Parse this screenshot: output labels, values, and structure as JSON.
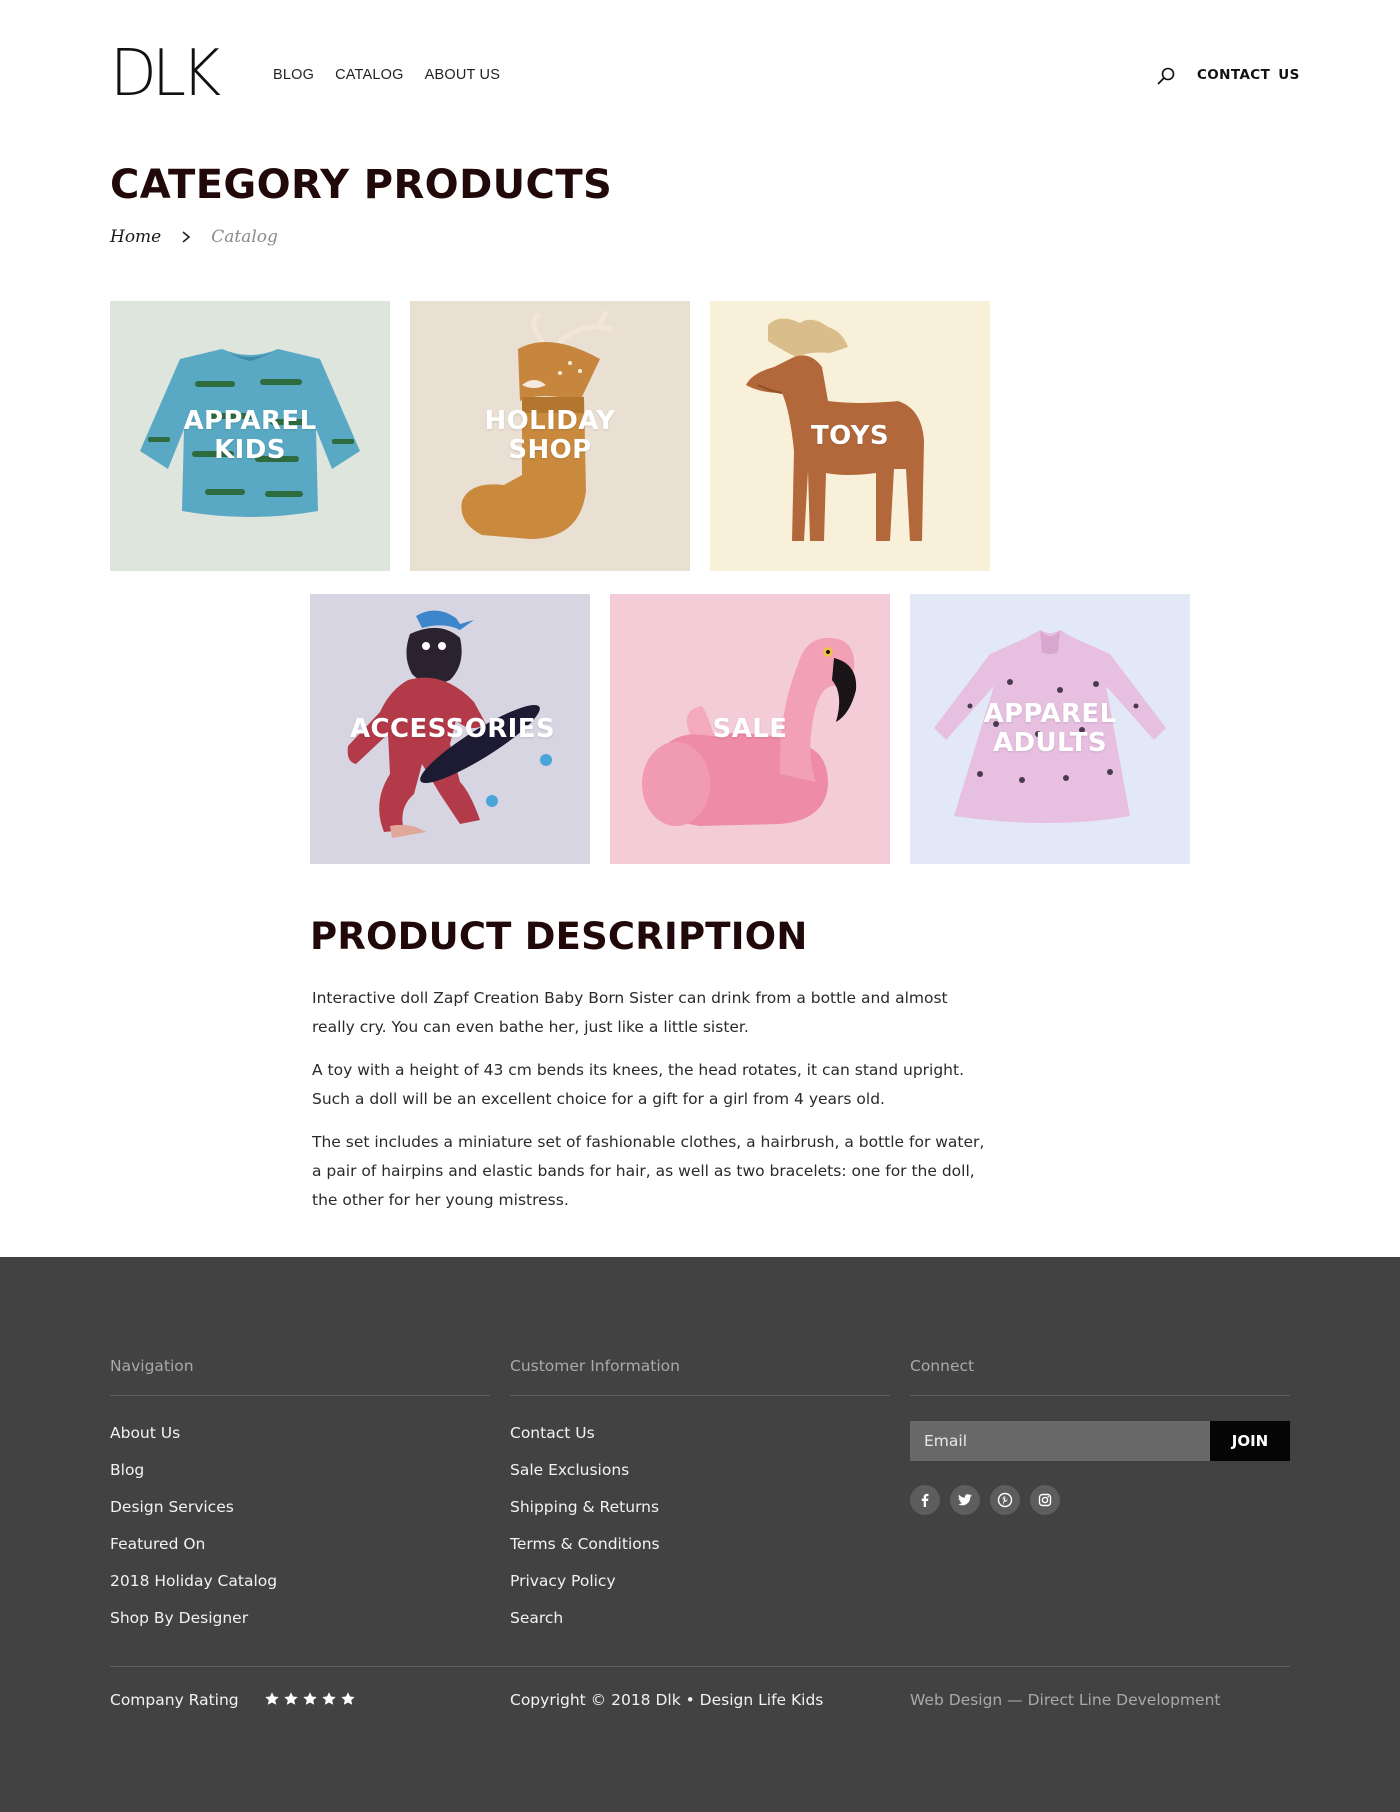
{
  "header": {
    "logo": "DLK",
    "nav": [
      "BLOG",
      "CATALOG",
      "ABOUT US"
    ],
    "contact": "CONTACT US"
  },
  "page": {
    "title": "CATEGORY PRODUCTS",
    "breadcrumb": {
      "home": "Home",
      "current": "Catalog"
    }
  },
  "categories": [
    {
      "label": "APPAREL KIDS",
      "bg": "#dde5dd"
    },
    {
      "label": "HOLIDAY SHOP",
      "bg": "#eadfd3"
    },
    {
      "label": "TOYS",
      "bg": "#f8f0d8"
    },
    {
      "label": "ACCESSORIES",
      "bg": "#d8d5e3"
    },
    {
      "label": "SALE",
      "bg": "#f3ccd8"
    },
    {
      "label": "APPAREL ADULTS",
      "bg": "#e3e8f6"
    }
  ],
  "description": {
    "title": "PRODUCT DESCRIPTION",
    "paragraphs": [
      "Interactive doll Zapf Creation Baby Born Sister can drink from a bottle and almost really cry. You can even bathe her, just like a little sister.",
      "A toy with a height of 43 cm bends its knees, the head rotates, it can stand upright. Such a doll will be an excellent choice for a gift for a girl from 4 years old.",
      "The set includes a miniature set of fashionable clothes, a hairbrush, a bottle for water, a pair of hairpins and elastic bands for hair, as well as two bracelets: one for the doll, the other for her young mistress."
    ]
  },
  "footer": {
    "navigation": {
      "heading": "Navigation",
      "links": [
        "About Us",
        "Blog",
        "Design Services",
        "Featured On",
        "2018 Holiday Catalog",
        "Shop By Designer"
      ]
    },
    "customer": {
      "heading": "Customer Information",
      "links": [
        "Contact Us",
        "Sale Exclusions",
        "Shipping & Returns",
        "Terms & Conditions",
        "Privacy Policy",
        "Search"
      ]
    },
    "connect": {
      "heading": "Connect",
      "email_placeholder": "Email",
      "join_label": "JOIN",
      "socials": [
        "facebook-icon",
        "twitter-icon",
        "pinterest-icon",
        "instagram-icon"
      ]
    },
    "rating_label": "Company Rating",
    "rating_stars": 5,
    "copyright": "Copyright © 2018 Dlk • Design Life Kids",
    "credit": "Web Design — Direct Line Development"
  },
  "colors": {
    "title": "#21090a",
    "footer_bg": "#424242",
    "join_bg": "#050505"
  }
}
